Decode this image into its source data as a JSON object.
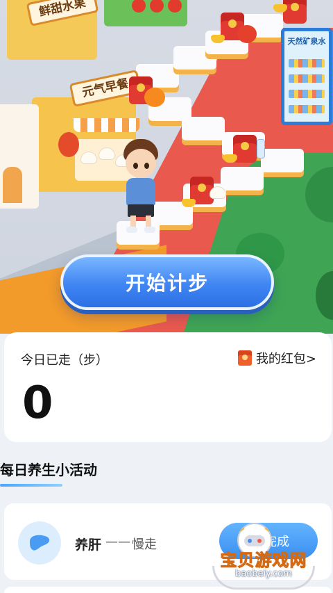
{
  "scene": {
    "fruit_shop_sign": "鲜甜水果",
    "breakfast_shop_sign": "元气早餐",
    "vending_sign": "天然矿泉水"
  },
  "start_button": {
    "label": "开始计步"
  },
  "steps_card": {
    "label": "今日已走（步）",
    "redpacket_link": "我的红包>",
    "count": "0"
  },
  "activities": {
    "section_title": "每日养生小活动",
    "items": [
      {
        "icon": "liver-icon",
        "name": "养肝",
        "separator": "——",
        "desc": "慢走",
        "button": "完成"
      }
    ]
  },
  "watermark": {
    "title": "宝贝游戏网",
    "url": "baobeiy.com"
  },
  "colors": {
    "primary": "#3f85f3",
    "accent_red": "#e13a33",
    "background": "#eef2f7"
  }
}
